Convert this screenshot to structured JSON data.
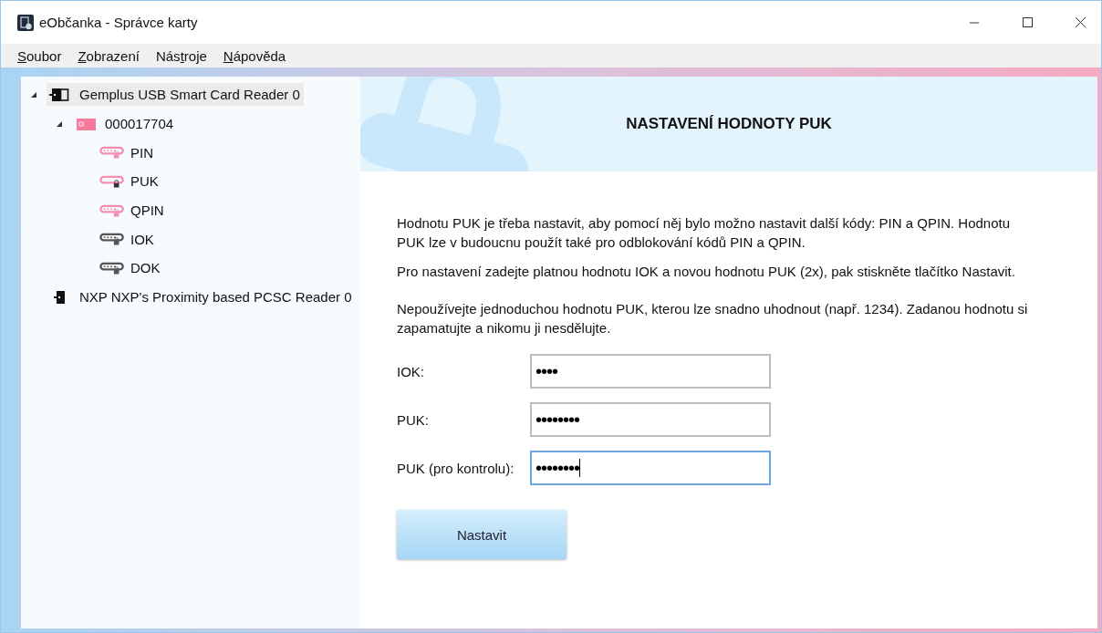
{
  "window": {
    "title": "eObčanka - Správce karty"
  },
  "menu": [
    {
      "key": "S",
      "after": "oubor"
    },
    {
      "key": "Z",
      "after": "obrazení"
    },
    {
      "before": "Nás",
      "key": "t",
      "after": "roje"
    },
    {
      "key": "N",
      "after": "ápověda"
    }
  ],
  "tree": [
    {
      "kind": "reader",
      "label": "Gemplus USB Smart Card Reader 0",
      "selected": true,
      "expanded": true,
      "children": [
        {
          "kind": "card",
          "label": "000017704",
          "selected": false,
          "expanded": true,
          "children": [
            {
              "kind": "code",
              "label": "PIN",
              "selected": false,
              "color": "#f48fb1",
              "set": true
            },
            {
              "kind": "code",
              "label": "PUK",
              "selected": false,
              "color": "#f48fb1",
              "set": false
            },
            {
              "kind": "code",
              "label": "QPIN",
              "selected": false,
              "color": "#f48fb1",
              "set": true
            },
            {
              "kind": "code",
              "label": "IOK",
              "selected": false,
              "color": "#555555",
              "set": true
            },
            {
              "kind": "code",
              "label": "DOK",
              "selected": false,
              "color": "#555555",
              "set": true
            }
          ]
        }
      ]
    },
    {
      "kind": "reader",
      "label": "NXP NXP's Proximity based PCSC Reader 0",
      "selected": false,
      "expanded": false
    }
  ],
  "panel": {
    "heading": "NASTAVENÍ HODNOTY PUK",
    "paragraphs": [
      "Hodnotu PUK je třeba nastavit, aby pomocí něj bylo možno nastavit další kódy: PIN a QPIN. Hodnotu PUK lze v budoucnu použít také pro odblokování kódů PIN a QPIN.",
      "Pro nastavení zadejte platnou hodnotu IOK a novou hodnotu PUK (2x), pak stiskněte tlačítko Nastavit.",
      "Nepoužívejte jednoduchou hodnotu PUK, kterou lze snadno uhodnout (např. 1234). Zadanou hodnotu si zapamatujte a nikomu ji nesdělujte."
    ],
    "fields": [
      {
        "label": "IOK:",
        "value": "••••",
        "focused": false
      },
      {
        "label": "PUK:",
        "value": "••••••••",
        "focused": false
      },
      {
        "label": "PUK (pro kontrolu):",
        "value": "••••••••",
        "focused": true
      }
    ],
    "button": "Nastavit"
  }
}
